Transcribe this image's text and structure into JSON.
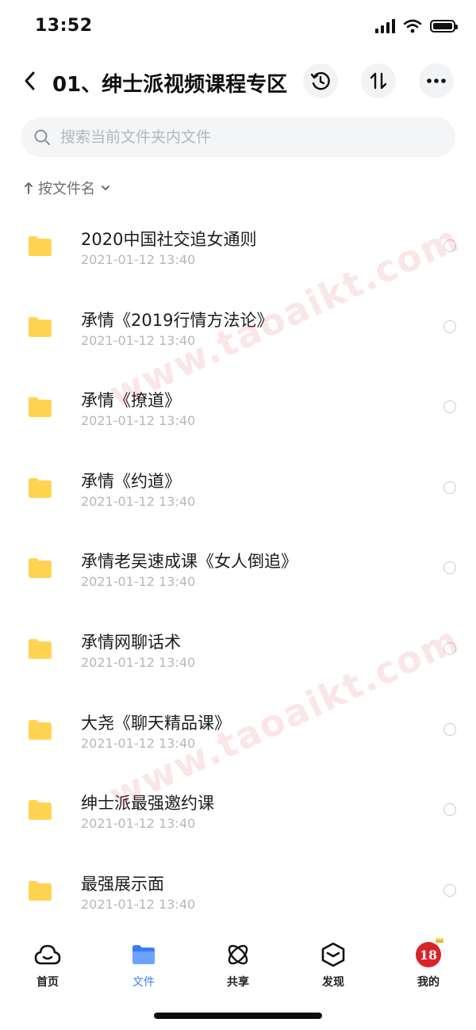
{
  "status_bar": {
    "time": "13:52"
  },
  "header": {
    "title": "01、绅士派视频课程专区"
  },
  "search": {
    "placeholder": "搜索当前文件夹内文件"
  },
  "sort": {
    "label": "按文件名"
  },
  "files": [
    {
      "name": "2020中国社交追女通则",
      "date": "2021-01-12 13:40"
    },
    {
      "name": "承情《2019行情方法论》",
      "date": "2021-01-12 13:40"
    },
    {
      "name": "承情《撩道》",
      "date": "2021-01-12 13:40"
    },
    {
      "name": "承情《约道》",
      "date": "2021-01-12 13:40"
    },
    {
      "name": "承情老吴速成课《女人倒追》",
      "date": "2021-01-12 13:40"
    },
    {
      "name": "承情网聊话术",
      "date": "2021-01-12 13:40"
    },
    {
      "name": "大尧《聊天精品课》",
      "date": "2021-01-12 13:40"
    },
    {
      "name": "绅士派最强邀约课",
      "date": "2021-01-12 13:40"
    },
    {
      "name": "最强展示面",
      "date": "2021-01-12 13:40"
    }
  ],
  "watermark": "www.taoaikt.com",
  "tabs": [
    {
      "label": "首页",
      "icon": "cloud-icon"
    },
    {
      "label": "文件",
      "icon": "folder-icon",
      "active": true
    },
    {
      "label": "共享",
      "icon": "orbit-icon"
    },
    {
      "label": "发现",
      "icon": "cube-icon"
    },
    {
      "label": "我的",
      "icon": "avatar-icon",
      "badge": "18"
    }
  ],
  "colors": {
    "accent": "#3b7cf6",
    "folder": "#ffd452",
    "badge": "#d9232a"
  }
}
